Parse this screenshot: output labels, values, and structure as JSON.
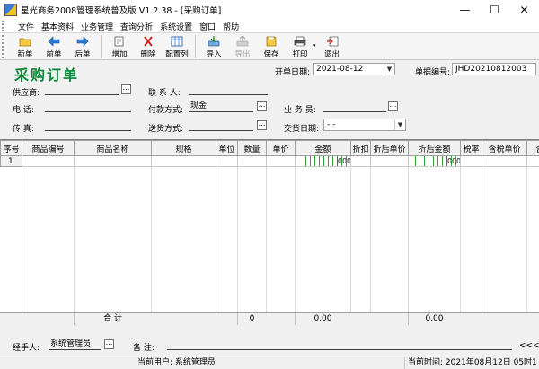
{
  "window": {
    "title": "星光商务2008管理系统普及版 V1.2.38 - [采购订单]",
    "minimize": "—",
    "maximize": "☐",
    "close": "✕"
  },
  "menu": [
    "文件",
    "基本资料",
    "业务管理",
    "查询分析",
    "系统设置",
    "窗口",
    "帮助"
  ],
  "toolbar": {
    "new": "新单",
    "prev": "前单",
    "next": "后单",
    "add_row": "增加",
    "delete": "删除",
    "config_cols": "配置列",
    "import": "导入",
    "export": "导出",
    "save": "保存",
    "print": "打印",
    "print_arrow": "▾",
    "call_out": "调出"
  },
  "form": {
    "title": "采购订单",
    "open_date_label": "开单日期:",
    "open_date_value": "2021-08-12",
    "doc_no_label": "单据编号:",
    "doc_no_value": "JHD20210812003",
    "supplier_label": "供应商:",
    "supplier_value": "",
    "contact_label": "联 系 人:",
    "contact_value": "",
    "phone_label": "电    话:",
    "phone_value": "",
    "payment_label": "付款方式:",
    "payment_value": "现金",
    "salesman_label": "业 务 员:",
    "salesman_value": "",
    "fax_label": "传    真:",
    "fax_value": "",
    "delivery_label": "送货方式:",
    "delivery_value": "",
    "trade_date_label": "交货日期:",
    "trade_date_value": " - - ",
    "dots": "…",
    "arrow": "▼"
  },
  "grid": {
    "columns": [
      "序号",
      "商品编号",
      "商品名称",
      "规格",
      "单位",
      "数量",
      "单价",
      "金额",
      "折扣",
      "折后单价",
      "折后金额",
      "税率",
      "含税单价",
      "含"
    ],
    "rows": [
      {
        "no": "1",
        "amount_digits": [
          "0",
          "0",
          "0"
        ],
        "disc_amount_digits": [
          "0",
          "0",
          "0"
        ]
      }
    ]
  },
  "totals": {
    "label": "合 计",
    "quantity": "0",
    "amount": "0.00",
    "disc_amount": "0.00"
  },
  "footer": {
    "handler_label": "经手人:",
    "handler_value": "系统管理员",
    "remark_label": "备  注:",
    "remark_value": "",
    "collapse": "<<<"
  },
  "status": {
    "user_label": "当前用户:",
    "user_value": "系统管理员",
    "time_label": "当前时间:",
    "time_value": "2021年08月12日 05时1"
  },
  "colors": {
    "title_green": "#0a8a3a",
    "digit_green": "#33a033",
    "digit_red": "#d03030"
  }
}
